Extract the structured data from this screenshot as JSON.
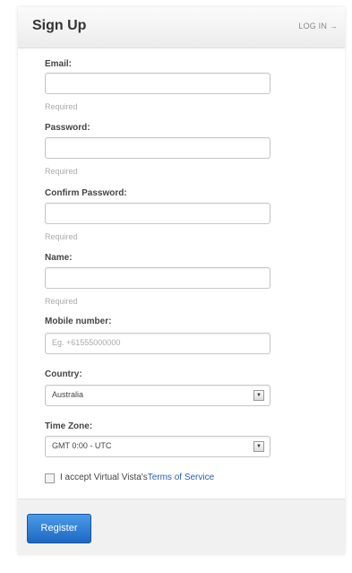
{
  "header": {
    "title": "Sign Up",
    "login_label": "LOG IN",
    "login_icon": "arrow-right-icon"
  },
  "form": {
    "email": {
      "label": "Email:",
      "value": "",
      "hint": "Required"
    },
    "password": {
      "label": "Password:",
      "value": "",
      "hint": "Required"
    },
    "confirm_password": {
      "label": "Confirm Password:",
      "value": "",
      "hint": "Required"
    },
    "name": {
      "label": "Name:",
      "value": "",
      "hint": "Required"
    },
    "mobile": {
      "label": "Mobile number:",
      "placeholder": "Eg. +61555000000"
    },
    "country": {
      "label": "Country:",
      "selected": "Australia"
    },
    "timezone": {
      "label": "Time Zone:",
      "selected": "GMT 0:00 - UTC"
    },
    "terms": {
      "checked": false,
      "text": "I accept Virtual Vista's",
      "link": "Terms of Service"
    }
  },
  "footer": {
    "register_label": "Register"
  },
  "colors": {
    "link": "#2a5db0",
    "button": "#1d67c3"
  }
}
